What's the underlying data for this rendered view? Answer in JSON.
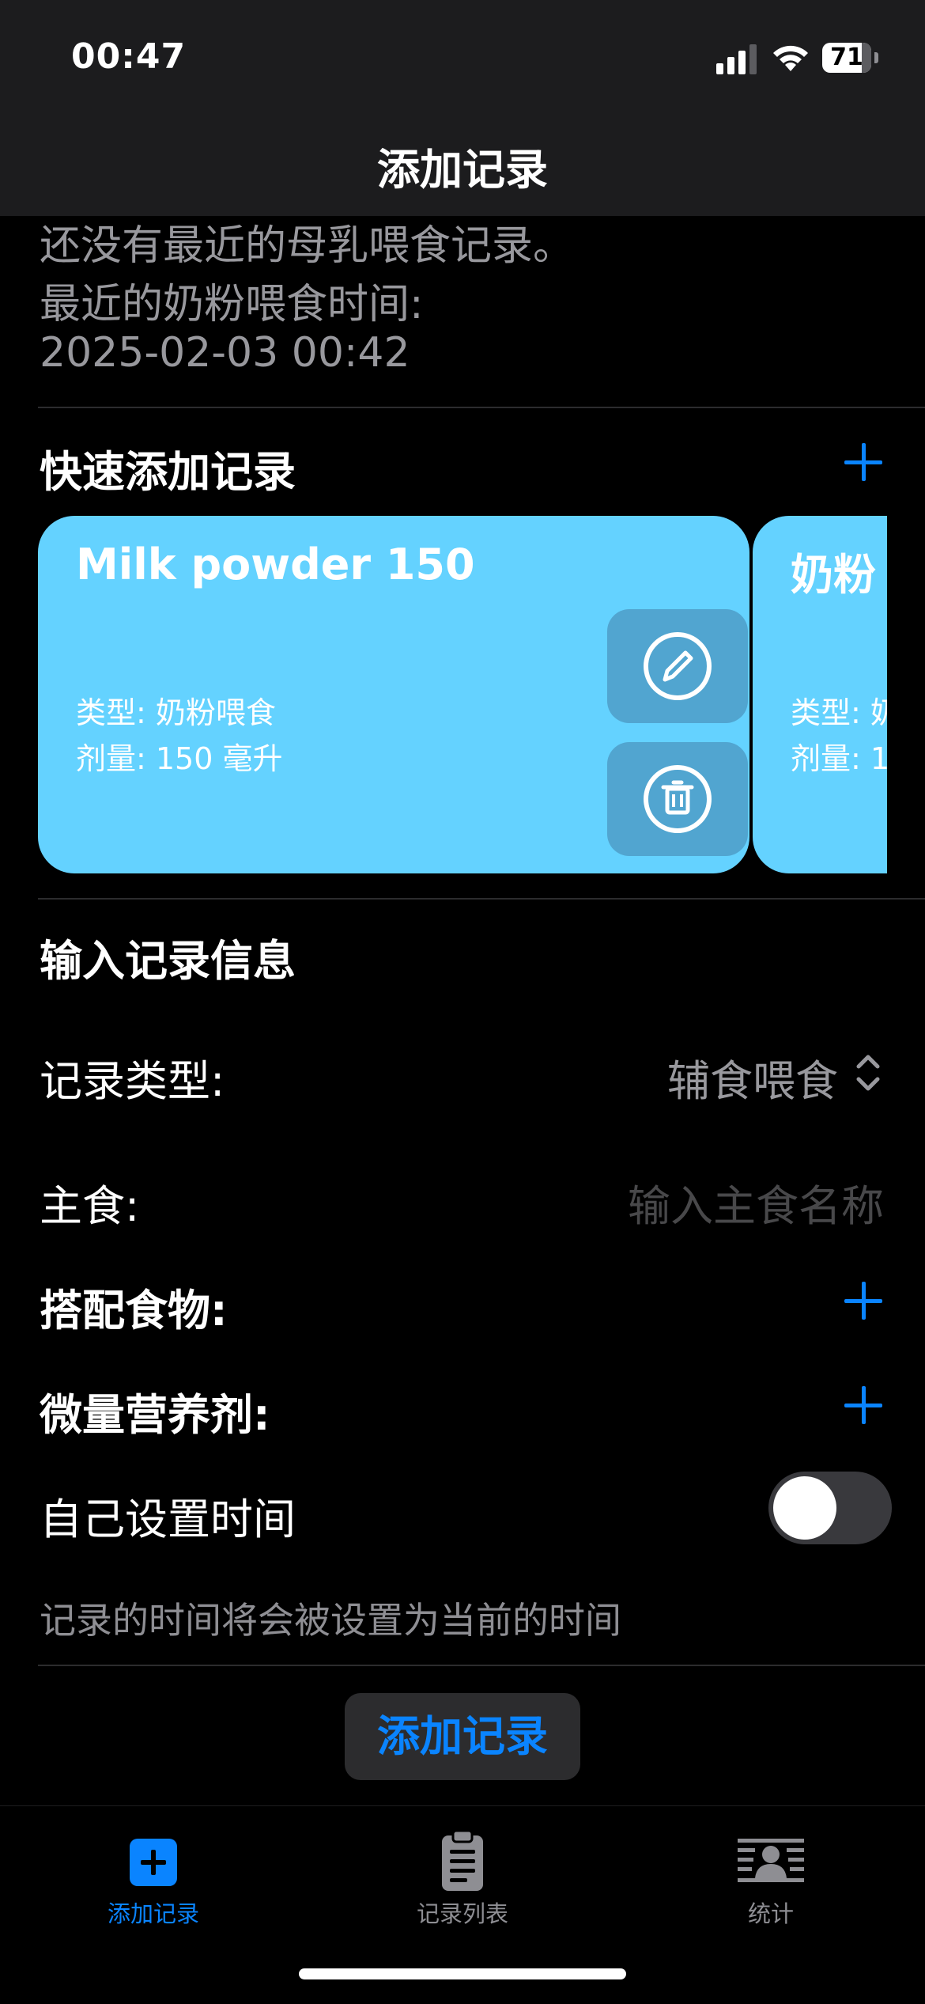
{
  "status_bar": {
    "time": "00:47",
    "battery": "71"
  },
  "nav": {
    "title": "添加记录"
  },
  "recent": {
    "breast_milk": "还没有最近的母乳喂食记录。",
    "formula_label": "最近的奶粉喂食时间:",
    "formula_time": "2025-02-03 00:42"
  },
  "quick_add": {
    "title": "快速添加记录",
    "cards": [
      {
        "title": "Milk powder 150",
        "type_line": "类型: 奶粉喂食",
        "dose_line": "剂量: 150 毫升"
      },
      {
        "title": "奶粉",
        "type_line": "类型: 奶",
        "dose_line": "剂量: 1"
      }
    ]
  },
  "form": {
    "title": "输入记录信息",
    "record_type_label": "记录类型:",
    "record_type_value": "辅食喂食",
    "staple_label": "主食:",
    "staple_placeholder": "输入主食名称",
    "side_food_label": "搭配食物:",
    "micronutrient_label": "微量营养剂:",
    "custom_time_label": "自己设置时间",
    "custom_time_enabled": false,
    "time_hint": "记录的时间将会被设置为当前的时间",
    "submit_label": "添加记录"
  },
  "tabs": [
    {
      "label": "添加记录",
      "icon": "plus-square-icon",
      "selected": true
    },
    {
      "label": "记录列表",
      "icon": "clipboard-icon",
      "selected": false
    },
    {
      "label": "统计",
      "icon": "person-stats-icon",
      "selected": false
    }
  ],
  "colors": {
    "accent": "#0a84ff",
    "card": "#64d2ff",
    "background": "#000000",
    "bar": "#1c1c1e",
    "secondary_text": "#98989d"
  }
}
